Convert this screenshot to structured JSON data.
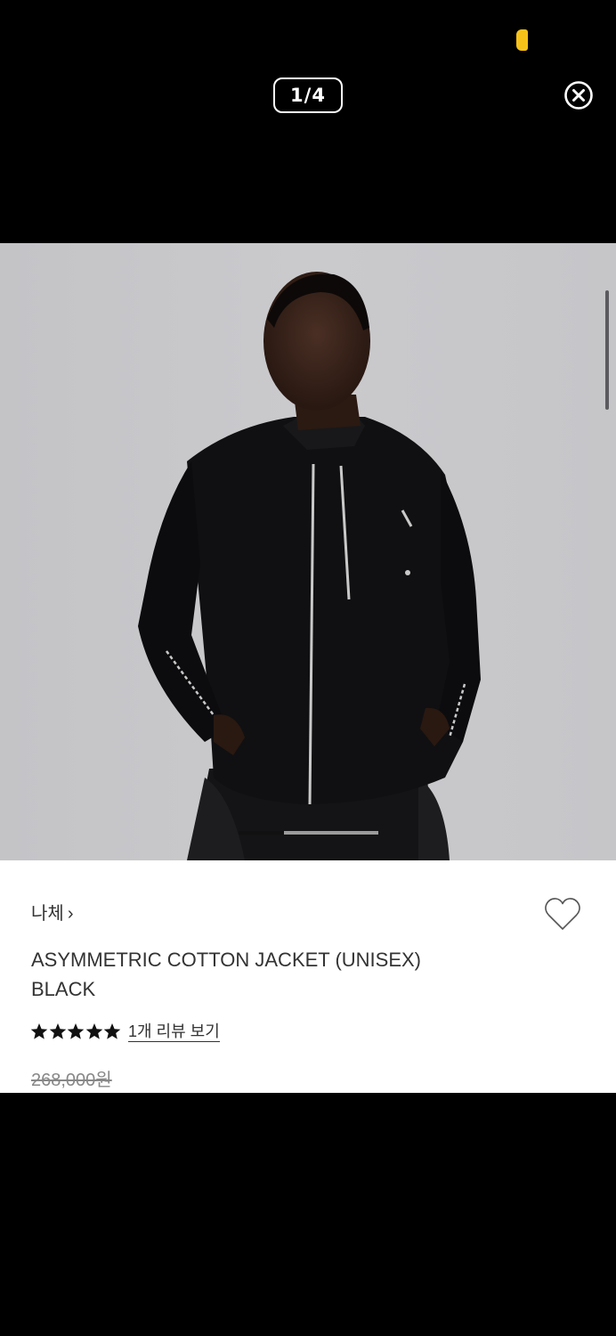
{
  "viewer": {
    "counter": "1/4",
    "close_icon": "close-circle-icon"
  },
  "product": {
    "brand": "나체",
    "brand_chevron": "›",
    "title_line1": "ASYMMETRIC COTTON JACKET (UNISEX)",
    "title_line2": "BLACK",
    "rating_stars": 5,
    "review_link": "1개 리뷰 보기",
    "original_price": "268,000원",
    "wishlist_icon": "heart-outline-icon"
  },
  "colors": {
    "background": "#000000",
    "photo_backdrop": "#c6c6c9",
    "status_indicator": "#f6c21a",
    "text": "#333333",
    "price_strike": "#888888"
  }
}
